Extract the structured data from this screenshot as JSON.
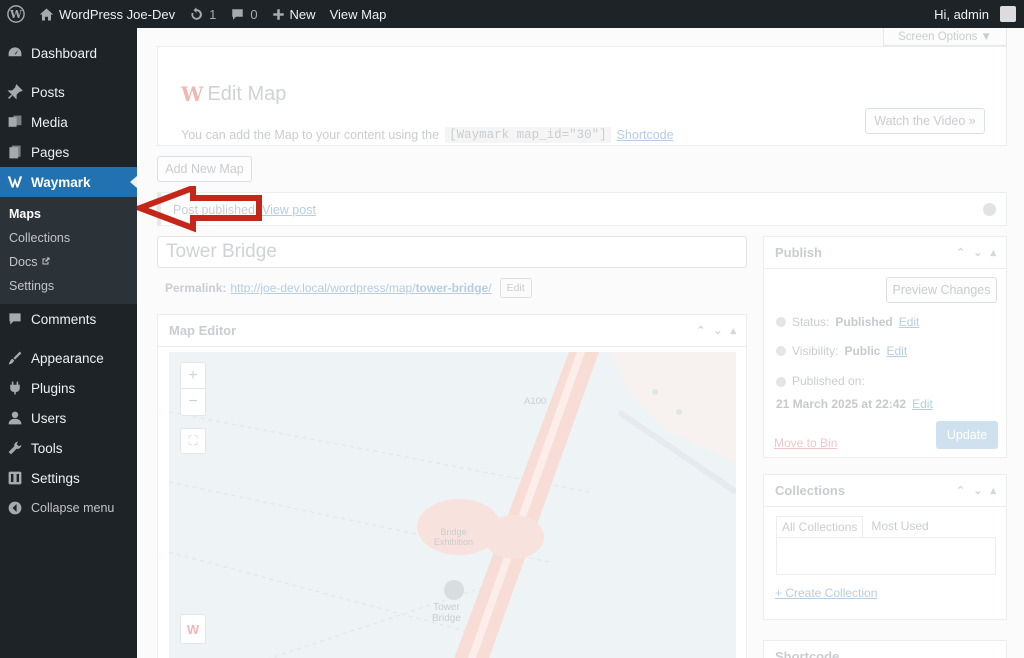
{
  "adminbar": {
    "site_name": "WordPress Joe-Dev",
    "updates_count": "1",
    "comments_count": "0",
    "new_label": "New",
    "view_label": "View Map",
    "greeting": "Hi, admin"
  },
  "sidebar": {
    "items": [
      {
        "label": "Dashboard",
        "icon": "dashboard-icon"
      },
      {
        "label": "Posts",
        "icon": "pin-icon"
      },
      {
        "label": "Media",
        "icon": "media-icon"
      },
      {
        "label": "Pages",
        "icon": "pages-icon"
      },
      {
        "label": "Waymark",
        "icon": "waymark-icon"
      },
      {
        "label": "Comments",
        "icon": "comment-icon"
      },
      {
        "label": "Appearance",
        "icon": "brush-icon"
      },
      {
        "label": "Plugins",
        "icon": "plugin-icon"
      },
      {
        "label": "Users",
        "icon": "user-icon"
      },
      {
        "label": "Tools",
        "icon": "wrench-icon"
      },
      {
        "label": "Settings",
        "icon": "settings-icon"
      },
      {
        "label": "Collapse menu",
        "icon": "collapse-icon"
      }
    ],
    "waymark_sub": [
      "Maps",
      "Collections",
      "Docs",
      "Settings"
    ]
  },
  "content": {
    "screen_options": "Screen Options ▼",
    "page_title": "Edit Map",
    "desc_prefix": "You can add the Map to your content using the",
    "shortcode": "[Waymark map_id=\"30\"]",
    "shortcode_link": "Shortcode",
    "watch_video": "Watch the Video »",
    "add_new": "Add New Map",
    "notice_text": "Post published.",
    "notice_link": "View post",
    "post_title": "Tower Bridge",
    "permalink_label": "Permalink:",
    "permalink_base": "http://joe-dev.local/wordpress/map/",
    "permalink_slug": "tower-bridge",
    "permalink_edit": "Edit",
    "map_editor_title": "Map Editor",
    "map_labels": {
      "road": "A100",
      "tower_bridge": "Tower\nBridge",
      "exhibition": "Bridge\nExhibition"
    }
  },
  "publish": {
    "title": "Publish",
    "preview": "Preview Changes",
    "status_label": "Status:",
    "status_value": "Published",
    "visibility_label": "Visibility:",
    "visibility_value": "Public",
    "published_label": "Published on:",
    "published_value": "21 March 2025 at 22:42",
    "edit": "Edit",
    "trash": "Move to Bin",
    "update": "Update"
  },
  "collections": {
    "title": "Collections",
    "tab_all": "All Collections",
    "tab_used": "Most Used",
    "create": "+ Create Collection"
  },
  "shortcode_box": {
    "title": "Shortcode"
  },
  "colors": {
    "accent": "#2271b1",
    "arrow": "#c4261a",
    "sidebar": "#1d2327"
  }
}
